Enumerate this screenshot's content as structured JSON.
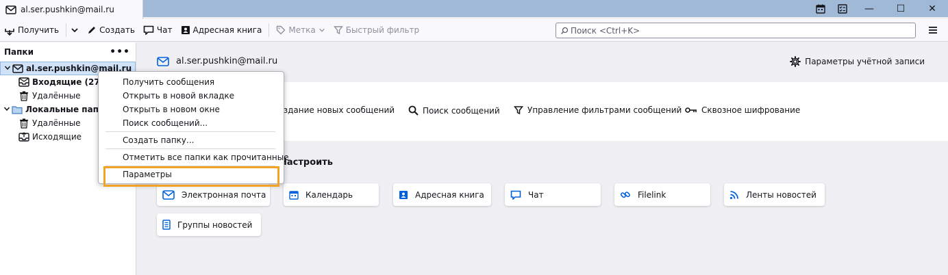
{
  "window": {
    "tab_title": "al.ser.pushkin@mail.ru",
    "controls": {
      "minimize": "—",
      "maximize": "☐",
      "close": "✕"
    }
  },
  "toolbar": {
    "get_messages": "Получить",
    "write": "Создать",
    "chat": "Чат",
    "address_book": "Адресная книга",
    "tag": "Метка",
    "quick_filter": "Быстрый фильтр",
    "search_placeholder": "Поиск <Ctrl+K>"
  },
  "folder_pane": {
    "title": "Папки",
    "more": "•••",
    "account": "al.ser.pushkin@mail.ru",
    "inbox": "Входящие (2776)",
    "trash": "Удалённые",
    "local_folders": "Локальные папки",
    "local_trash": "Удалённые",
    "outbox": "Исходящие"
  },
  "context_menu": {
    "items": [
      "Получить сообщения",
      "Открыть в новой вкладке",
      "Открыть в новом окне",
      "Поиск сообщений...",
      "Создать папку...",
      "Отметить все папки как прочитанные",
      "Параметры"
    ]
  },
  "account_central": {
    "account_name": "al.ser.pushkin@mail.ru",
    "account_settings": "Параметры учётной записи",
    "features": [
      "Создание новых сообщений",
      "Поиск сообщений",
      "Управление фильтрами сообщений",
      "Сквозное шифрование"
    ],
    "setup_title": "Настроить",
    "cards": [
      "Электронная почта",
      "Календарь",
      "Адресная книга",
      "Чат",
      "Filelink",
      "Ленты новостей",
      "Группы новостей"
    ]
  },
  "colors": {
    "titlebar": "#9fb9d6",
    "accent": "#0061e0",
    "highlight_outline": "#f3a324",
    "selection": "#cfe2f7"
  }
}
